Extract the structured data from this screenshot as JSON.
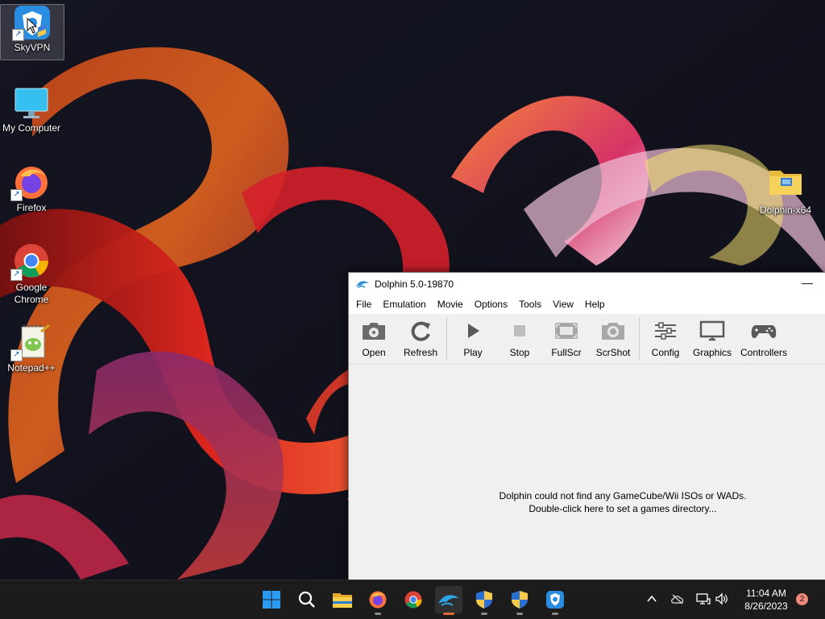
{
  "desktop": {
    "icons": [
      {
        "label": "SkyVPN",
        "icon": "skyvpn-icon"
      },
      {
        "label": "My Computer",
        "icon": "monitor-icon"
      },
      {
        "label": "Firefox",
        "icon": "firefox-icon"
      },
      {
        "label": "Google Chrome",
        "icon": "chrome-icon"
      },
      {
        "label": "Notepad++",
        "icon": "notepadpp-icon"
      },
      {
        "label": "Dolphin-x64",
        "icon": "folder-icon"
      }
    ]
  },
  "window": {
    "title": "Dolphin 5.0-19870",
    "minimize_glyph": "—",
    "menu": [
      "File",
      "Emulation",
      "Movie",
      "Options",
      "Tools",
      "View",
      "Help"
    ],
    "toolbar": [
      {
        "label": "Open",
        "icon": "open-icon"
      },
      {
        "label": "Refresh",
        "icon": "refresh-icon"
      },
      {
        "label": "Play",
        "icon": "play-icon"
      },
      {
        "label": "Stop",
        "icon": "stop-icon"
      },
      {
        "label": "FullScr",
        "icon": "fullscreen-icon"
      },
      {
        "label": "ScrShot",
        "icon": "camera-icon"
      },
      {
        "label": "Config",
        "icon": "sliders-icon"
      },
      {
        "label": "Graphics",
        "icon": "monitor-icon"
      },
      {
        "label": "Controllers",
        "icon": "gamepad-icon"
      }
    ],
    "empty_message_line1": "Dolphin could not find any GameCube/Wii ISOs or WADs.",
    "empty_message_line2": "Double-click here to set a games directory..."
  },
  "taskbar": {
    "apps": [
      "start-icon",
      "search-icon",
      "file-explorer-icon",
      "firefox-icon",
      "chrome-icon",
      "dolphin-icon",
      "shield-icon",
      "shield-icon",
      "skyvpn-icon"
    ],
    "active_app": "dolphin-icon",
    "time": "11:04 AM",
    "date": "8/26/2023",
    "notification_count": "2"
  },
  "colors": {
    "taskbar_bg": "#1c1c1c",
    "window_bg": "#f0f0f0",
    "active_indicator": "#e06a3a"
  }
}
